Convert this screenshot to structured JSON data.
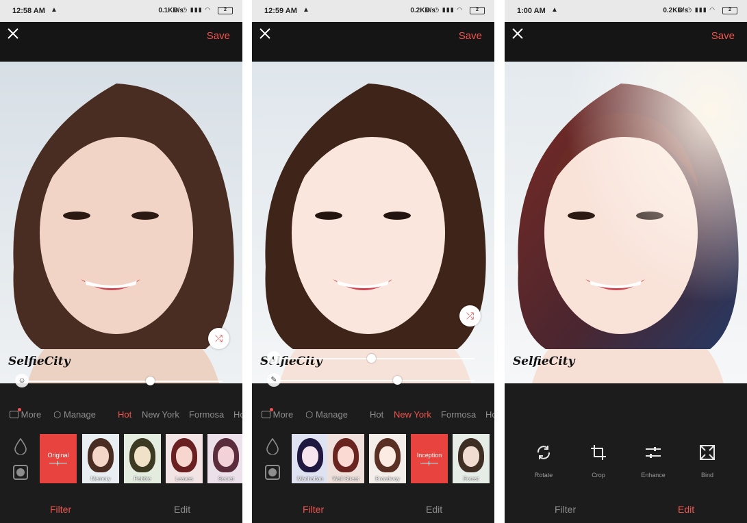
{
  "screens": [
    {
      "status": {
        "time": "12:58 AM",
        "net": "0.1KB/s",
        "battery": "2"
      },
      "topbar": {
        "save_label": "Save"
      },
      "watermark": "SelfieCity",
      "categories": [
        "More",
        "Manage",
        "Hot",
        "New York",
        "Formosa",
        "Ho"
      ],
      "active_category": "Hot",
      "filters": [
        "Original",
        "Memory",
        "Pebble",
        "Leaves",
        "Secret"
      ],
      "selected_filter": "Original",
      "tabs": {
        "filter": "Filter",
        "edit": "Edit"
      },
      "active_tab": "Filter"
    },
    {
      "status": {
        "time": "12:59 AM",
        "net": "0.2KB/s",
        "battery": "2"
      },
      "topbar": {
        "save_label": "Save"
      },
      "watermark": "SelfieCity",
      "categories": [
        "More",
        "Manage",
        "Hot",
        "New York",
        "Formosa",
        "Ho"
      ],
      "active_category": "New York",
      "filters": [
        "Manhattan",
        "Wall Street",
        "Broadway",
        "Inception",
        "Forest"
      ],
      "selected_filter": "Inception",
      "tabs": {
        "filter": "Filter",
        "edit": "Edit"
      },
      "active_tab": "Filter"
    },
    {
      "status": {
        "time": "1:00 AM",
        "net": "0.2KB/s",
        "battery": "2"
      },
      "topbar": {
        "save_label": "Save"
      },
      "watermark": "SelfieCity",
      "edit_tools": [
        "Rotate",
        "Crop",
        "Enhance",
        "Bind"
      ],
      "tabs": {
        "filter": "Filter",
        "edit": "Edit"
      },
      "active_tab": "Edit"
    }
  ],
  "colors": {
    "accent": "#f0544e",
    "bar": "#1c1c1c",
    "muted": "#8d8d8d"
  },
  "icons": [
    "close-icon",
    "shuffle-icon",
    "drop-icon",
    "vignette-icon",
    "rotate-icon",
    "crop-icon",
    "enhance-icon",
    "bind-icon"
  ]
}
